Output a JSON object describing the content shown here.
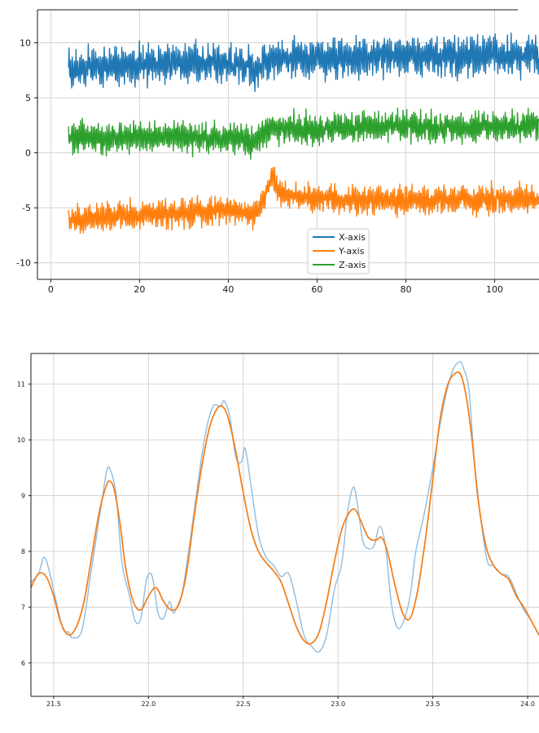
{
  "chart_data": [
    {
      "type": "line",
      "title": "",
      "xlabel": "",
      "ylabel": "",
      "xlim": [
        -3,
        110
      ],
      "ylim": [
        -11.5,
        13
      ],
      "x_ticks": [
        "0",
        "20",
        "40",
        "60",
        "80",
        "100"
      ],
      "x_tick_values": [
        0,
        20,
        40,
        60,
        80,
        100
      ],
      "y_ticks": [
        "10",
        "5",
        "0",
        "-5",
        "-10"
      ],
      "y_tick_values": [
        10,
        5,
        0,
        -5,
        -10
      ],
      "grid": true,
      "legend_position": "bottom-center",
      "series": [
        {
          "name": "X-axis",
          "color": "#1f77b4",
          "x": [
            4,
            10,
            20,
            30,
            40,
            46,
            47,
            48,
            50,
            60,
            70,
            80,
            90,
            100,
            110
          ],
          "values": [
            7.5,
            7.8,
            8.0,
            8.2,
            8.2,
            7.6,
            7.8,
            8.2,
            8.6,
            8.6,
            8.7,
            8.8,
            8.7,
            8.8,
            8.8
          ],
          "amp": 1.5
        },
        {
          "name": "Y-axis",
          "color": "#ff7f0e",
          "x": [
            4,
            10,
            20,
            30,
            40,
            46,
            47,
            48,
            49,
            50,
            51,
            53,
            60,
            70,
            80,
            90,
            100,
            110
          ],
          "values": [
            -6.2,
            -5.9,
            -5.6,
            -5.4,
            -5.2,
            -5.6,
            -5.1,
            -4.3,
            -2.9,
            -2.0,
            -3.2,
            -3.9,
            -4.1,
            -4.3,
            -4.4,
            -4.3,
            -4.2,
            -4.2
          ],
          "amp": 1.1
        },
        {
          "name": "Z-axis",
          "color": "#2ca02c",
          "x": [
            4,
            10,
            20,
            30,
            40,
            46,
            47,
            48,
            50,
            60,
            70,
            80,
            90,
            100,
            110
          ],
          "values": [
            1.5,
            1.4,
            1.4,
            1.5,
            1.3,
            1.1,
            1.4,
            1.8,
            2.2,
            2.2,
            2.3,
            2.4,
            2.3,
            2.4,
            2.4
          ],
          "amp": 1.2
        }
      ]
    },
    {
      "type": "line",
      "title": "",
      "xlabel": "",
      "ylabel": "",
      "xlim": [
        21.38,
        24.06
      ],
      "ylim": [
        5.4,
        11.55
      ],
      "x_ticks": [
        "21.5",
        "22.0",
        "22.5",
        "23.0",
        "23.5",
        "24.0"
      ],
      "x_tick_values": [
        21.5,
        22.0,
        22.5,
        23.0,
        23.5,
        24.0
      ],
      "y_ticks": [
        "11",
        "10",
        "9",
        "8",
        "7",
        "6"
      ],
      "y_tick_values": [
        11,
        10,
        9,
        8,
        7,
        6
      ],
      "grid": true,
      "series": [
        {
          "name": "",
          "color": "#8fbcdf",
          "x": [
            21.38,
            21.42,
            21.45,
            21.48,
            21.52,
            21.55,
            21.58,
            21.6,
            21.65,
            21.7,
            21.75,
            21.78,
            21.8,
            21.83,
            21.86,
            21.9,
            21.93,
            21.96,
            21.99,
            22.02,
            22.05,
            22.08,
            22.11,
            22.13,
            22.15,
            22.18,
            22.22,
            22.26,
            22.3,
            22.34,
            22.38,
            22.4,
            22.43,
            22.46,
            22.49,
            22.51,
            22.54,
            22.58,
            22.62,
            22.66,
            22.7,
            22.74,
            22.78,
            22.82,
            22.86,
            22.9,
            22.94,
            22.98,
            23.02,
            23.05,
            23.08,
            23.1,
            23.13,
            23.16,
            23.19,
            23.22,
            23.25,
            23.28,
            23.31,
            23.34,
            23.38,
            23.41,
            23.45,
            23.5,
            23.55,
            23.6,
            23.64,
            23.66,
            23.69,
            23.72,
            23.76,
            23.79,
            23.82,
            23.86,
            23.9,
            23.94,
            23.98,
            24.02,
            24.06
          ],
          "values": [
            7.45,
            7.6,
            7.9,
            7.6,
            7.0,
            6.6,
            6.55,
            6.45,
            6.6,
            7.7,
            8.8,
            9.45,
            9.45,
            9.0,
            7.8,
            7.2,
            6.75,
            6.8,
            7.5,
            7.55,
            6.9,
            6.8,
            7.1,
            6.9,
            7.0,
            7.3,
            8.2,
            9.2,
            10.1,
            10.6,
            10.6,
            10.7,
            10.4,
            9.7,
            9.6,
            9.85,
            9.2,
            8.3,
            7.9,
            7.75,
            7.55,
            7.6,
            7.1,
            6.5,
            6.3,
            6.2,
            6.5,
            7.3,
            7.8,
            8.7,
            9.15,
            8.9,
            8.2,
            8.05,
            8.1,
            8.45,
            8.1,
            7.1,
            6.65,
            6.7,
            7.2,
            8.0,
            8.6,
            9.5,
            10.5,
            11.2,
            11.4,
            11.3,
            10.9,
            9.6,
            8.4,
            7.8,
            7.75,
            7.6,
            7.55,
            7.25,
            6.95,
            6.75,
            6.5
          ]
        },
        {
          "name": "",
          "color": "#f5801e",
          "x": [
            21.38,
            21.42,
            21.46,
            21.5,
            21.54,
            21.58,
            21.62,
            21.66,
            21.7,
            21.74,
            21.78,
            21.8,
            21.82,
            21.85,
            21.88,
            21.92,
            21.96,
            22.0,
            22.04,
            22.08,
            22.12,
            22.16,
            22.2,
            22.24,
            22.28,
            22.32,
            22.36,
            22.39,
            22.42,
            22.46,
            22.5,
            22.54,
            22.58,
            22.62,
            22.66,
            22.7,
            22.74,
            22.78,
            22.82,
            22.86,
            22.9,
            22.94,
            22.98,
            23.02,
            23.06,
            23.09,
            23.12,
            23.16,
            23.2,
            23.23,
            23.26,
            23.3,
            23.34,
            23.38,
            23.42,
            23.46,
            23.5,
            23.54,
            23.58,
            23.62,
            23.65,
            23.68,
            23.71,
            23.74,
            23.78,
            23.82,
            23.86,
            23.9,
            23.94,
            23.98,
            24.02,
            24.06
          ],
          "values": [
            7.35,
            7.6,
            7.55,
            7.2,
            6.7,
            6.5,
            6.65,
            7.1,
            7.9,
            8.7,
            9.2,
            9.25,
            9.1,
            8.5,
            7.7,
            7.1,
            6.95,
            7.2,
            7.35,
            7.1,
            6.95,
            7.05,
            7.6,
            8.6,
            9.5,
            10.2,
            10.55,
            10.6,
            10.4,
            9.8,
            9.05,
            8.4,
            8.0,
            7.8,
            7.65,
            7.45,
            7.05,
            6.65,
            6.4,
            6.35,
            6.55,
            7.1,
            7.8,
            8.4,
            8.7,
            8.75,
            8.55,
            8.25,
            8.2,
            8.25,
            8.0,
            7.4,
            6.9,
            6.8,
            7.3,
            8.2,
            9.3,
            10.4,
            11.0,
            11.2,
            11.15,
            10.7,
            9.9,
            8.9,
            8.1,
            7.75,
            7.6,
            7.5,
            7.2,
            7.0,
            6.75,
            6.5
          ]
        }
      ]
    }
  ]
}
